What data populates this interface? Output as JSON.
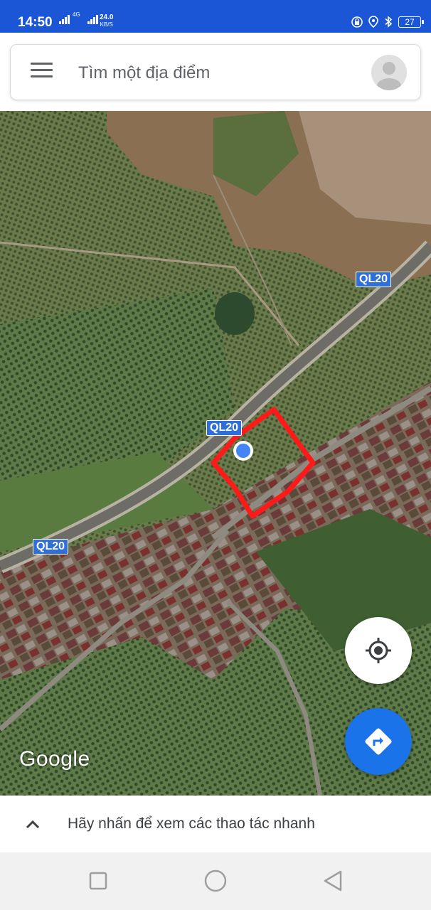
{
  "status_bar": {
    "time": "14:50",
    "network_label": "4G",
    "speed_value": "24.0",
    "speed_unit": "KB/S",
    "battery": "27",
    "icons": [
      "sim-icon",
      "signal-icon",
      "vpn-icon",
      "location-icon",
      "bluetooth-icon",
      "battery-icon"
    ],
    "color": "#1a56d6"
  },
  "search": {
    "placeholder": "Tìm một địa điểm",
    "menu_icon": "hamburger-menu-icon",
    "avatar_icon": "account-avatar-icon"
  },
  "map": {
    "type": "satellite",
    "road_labels": [
      "QL20",
      "QL20",
      "QL20"
    ],
    "logo": "Google",
    "annotation_color": "#ff1a1a",
    "location_dot_color": "#4285f4"
  },
  "fabs": {
    "location_icon": "my-location-icon",
    "directions_icon": "directions-icon",
    "directions_color": "#1a73e8"
  },
  "bottom_sheet": {
    "text": "Hãy nhấn để xem các thao tác nhanh",
    "icon": "chevron-up-icon"
  },
  "nav_bar": {
    "buttons": [
      "recent-apps-icon",
      "home-icon",
      "back-icon"
    ]
  }
}
